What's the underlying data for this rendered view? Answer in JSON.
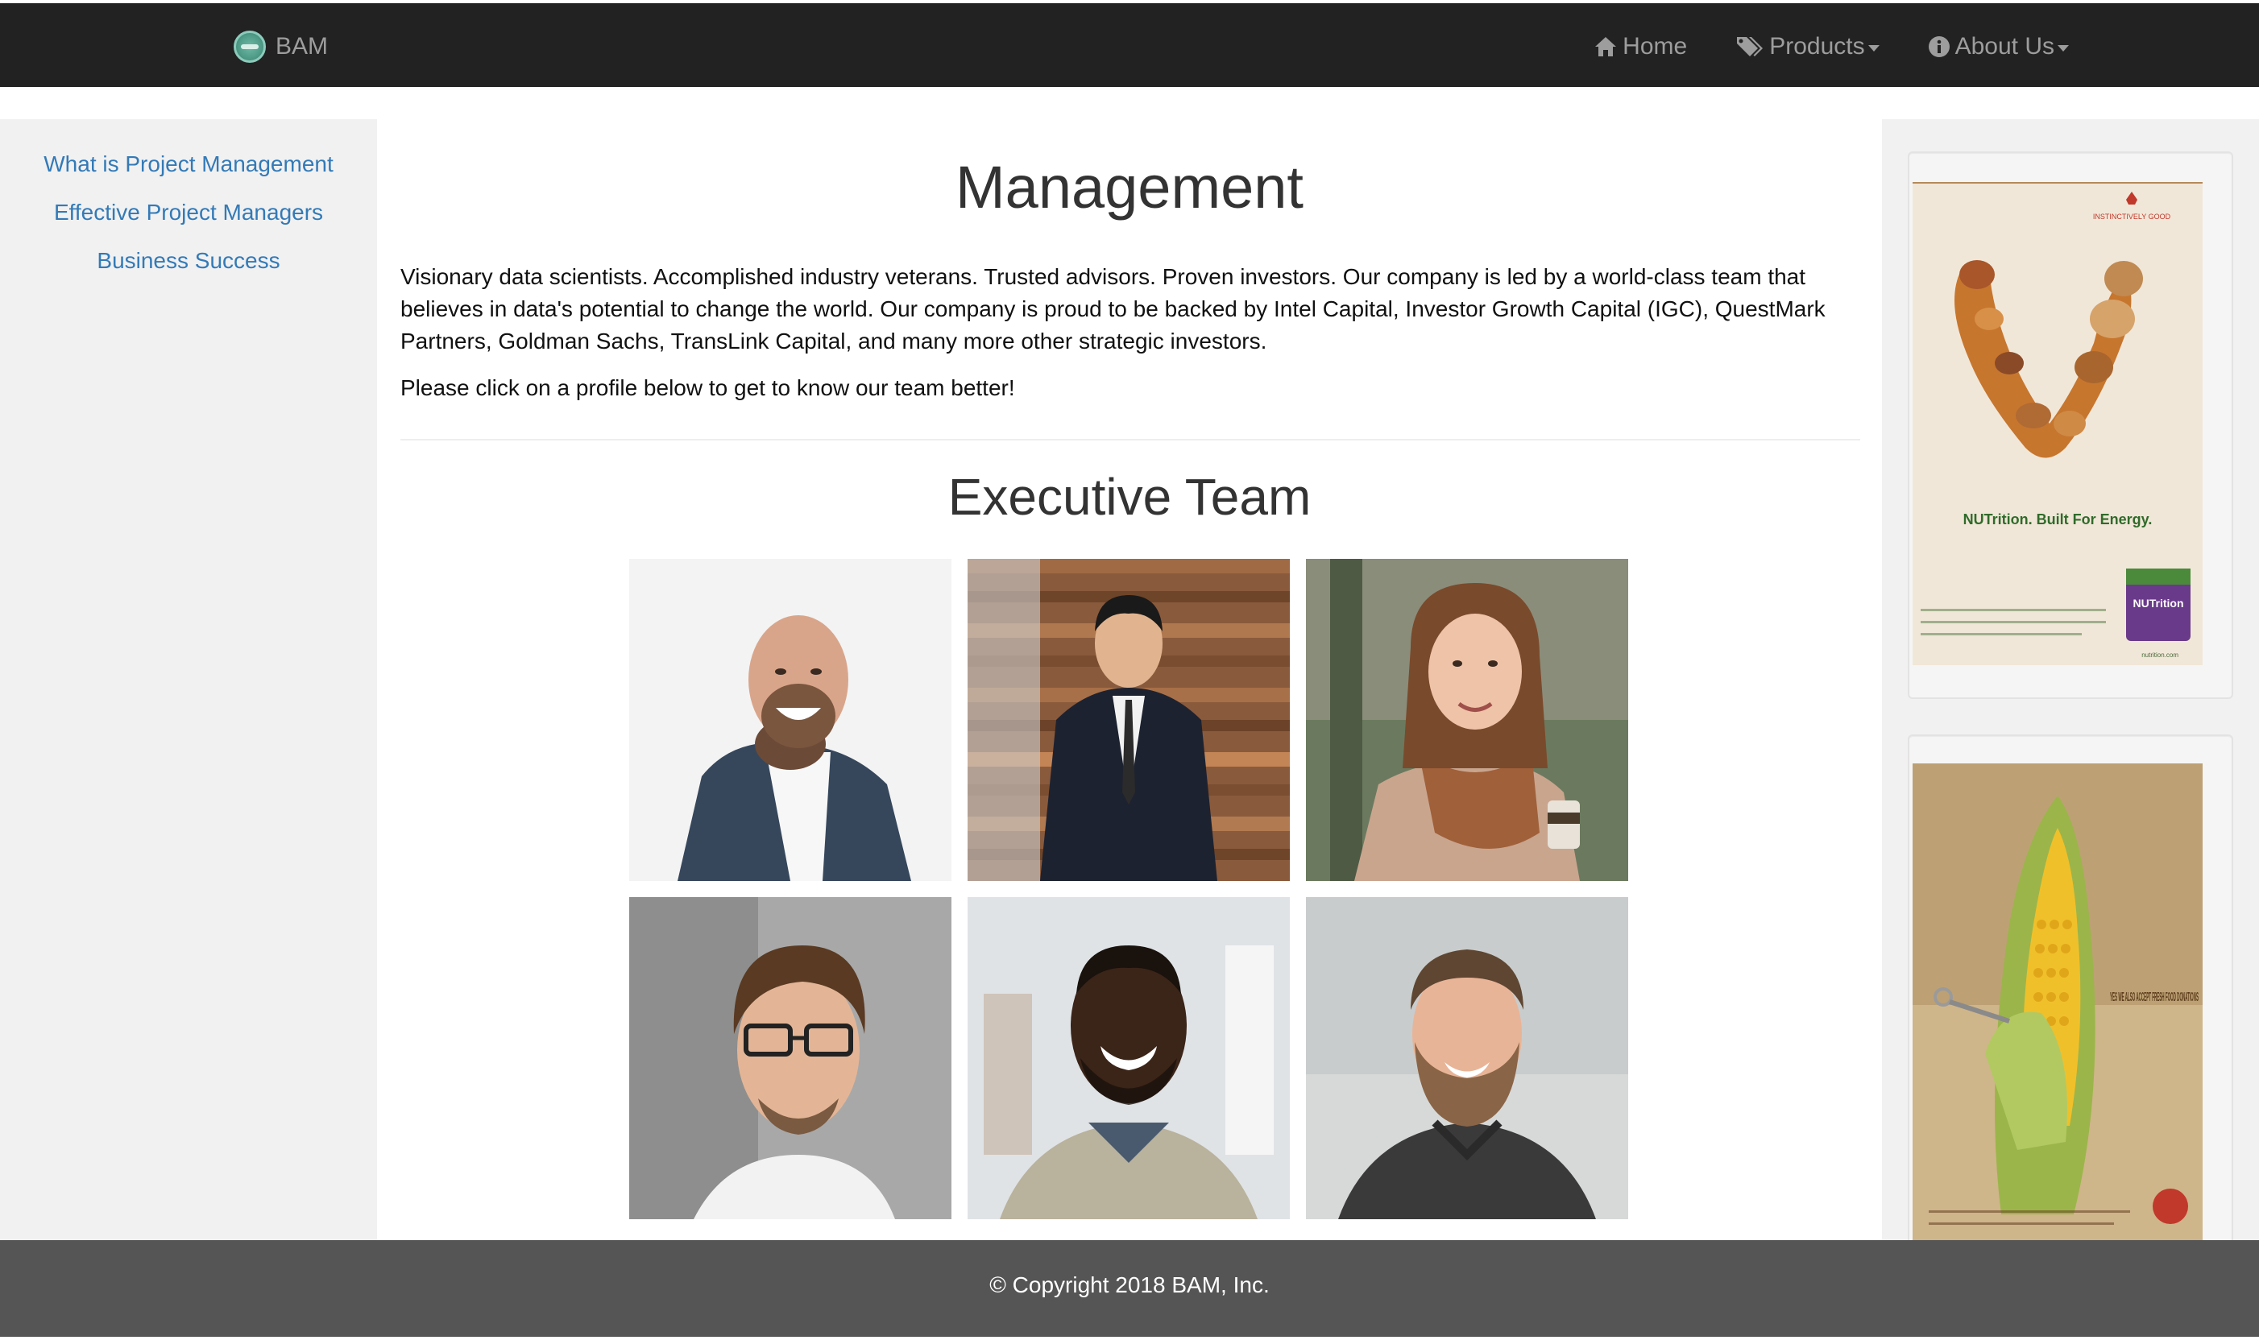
{
  "navbar": {
    "brand": "BAM",
    "items": [
      {
        "label": "Home",
        "icon": "home-icon"
      },
      {
        "label": "Products",
        "icon": "tags-icon",
        "dropdown": true
      },
      {
        "label": "About Us",
        "icon": "info-icon",
        "dropdown": true
      }
    ]
  },
  "sidenav": {
    "links": [
      "What is Project Management",
      "Effective Project Managers",
      "Business Success"
    ]
  },
  "main": {
    "title": "Management",
    "intro": "Visionary data scientists. Accomplished industry veterans. Trusted advisors. Proven investors. Our company is led by a world-class team that believes in data's potential to change the world. Our company is proud to be backed by Intel Capital, Investor Growth Capital (IGC), QuestMark Partners, Goldman Sachs, TransLink Capital, and many more other strategic investors.",
    "prompt": "Please click on a profile below to get to know our team better!",
    "section_title": "Executive Team",
    "team": [
      {
        "name": "team-member-1"
      },
      {
        "name": "team-member-2"
      },
      {
        "name": "team-member-3"
      },
      {
        "name": "team-member-4"
      },
      {
        "name": "team-member-5"
      },
      {
        "name": "team-member-6"
      }
    ]
  },
  "ads": [
    {
      "brand": "INSTINCTIVELY GOOD",
      "tagline": "NUTrition. Built For Energy.",
      "product": "NUTrition",
      "url": "nutrition.com"
    },
    {
      "headline": "YES WE ALSO ACCEPT FRESH FOOD DONATIONS"
    }
  ],
  "footer": {
    "copyright": "© Copyright 2018 BAM, Inc."
  },
  "colors": {
    "navbar_bg": "#222222",
    "nav_text": "#9d9d9d",
    "link": "#337ab7",
    "sidebar_bg": "#f1f1f1",
    "footer_bg": "#555555"
  }
}
